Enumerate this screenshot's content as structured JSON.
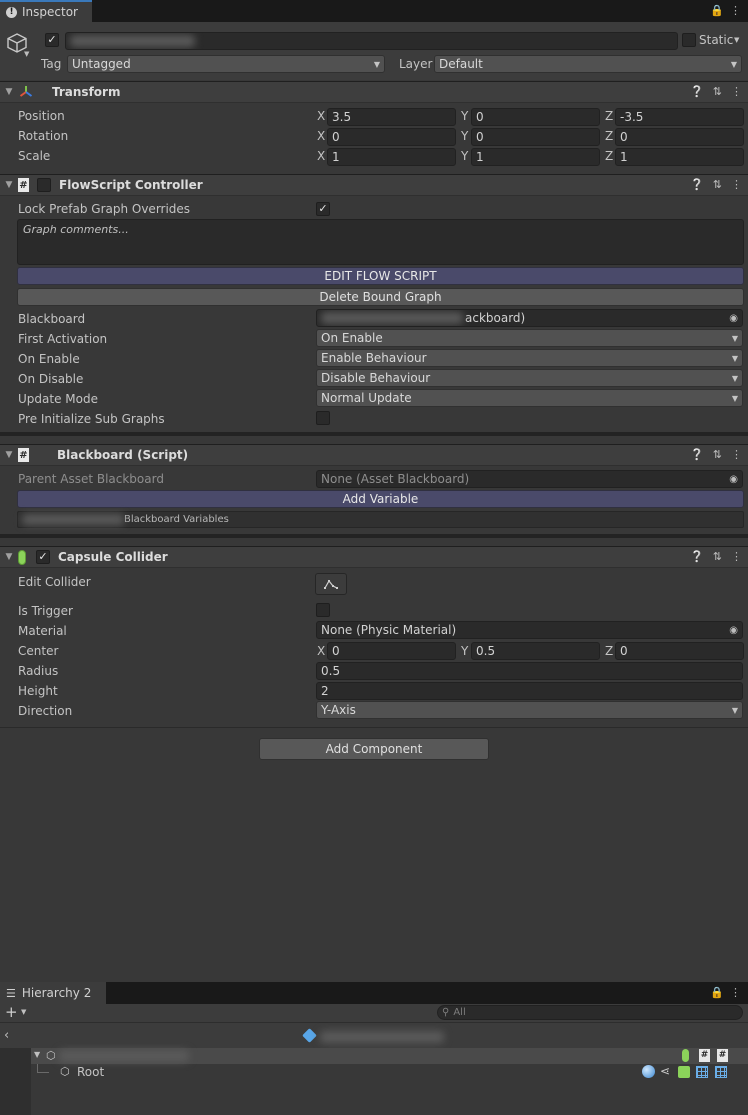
{
  "inspector": {
    "tab_label": "Inspector",
    "object": {
      "static_label": "Static"
    },
    "tag": {
      "label": "Tag",
      "value": "Untagged"
    },
    "layer": {
      "label": "Layer",
      "value": "Default"
    }
  },
  "transform": {
    "title": "Transform",
    "position": {
      "label": "Position",
      "x": "3.5",
      "y": "0",
      "z": "-3.5"
    },
    "rotation": {
      "label": "Rotation",
      "x": "0",
      "y": "0",
      "z": "0"
    },
    "scale": {
      "label": "Scale",
      "x": "1",
      "y": "1",
      "z": "1"
    },
    "axis": {
      "x": "X",
      "y": "Y",
      "z": "Z"
    }
  },
  "flowscript": {
    "title": "FlowScript Controller",
    "lock_label": "Lock Prefab Graph Overrides",
    "lock_checked": "✓",
    "comments_placeholder": "Graph comments...",
    "edit_button": "EDIT FLOW SCRIPT",
    "delete_button": "Delete Bound Graph",
    "blackboard_label": "Blackboard",
    "blackboard_value_suffix": "ackboard)",
    "first_activation": {
      "label": "First Activation",
      "value": "On Enable"
    },
    "on_enable": {
      "label": "On Enable",
      "value": "Enable Behaviour"
    },
    "on_disable": {
      "label": "On Disable",
      "value": "Disable Behaviour"
    },
    "update_mode": {
      "label": "Update Mode",
      "value": "Normal Update"
    },
    "pre_init": {
      "label": "Pre Initialize Sub Graphs"
    }
  },
  "blackboard": {
    "title": "Blackboard (Script)",
    "parent_label": "Parent Asset Blackboard",
    "parent_value": "None (Asset Blackboard)",
    "add_variable": "Add Variable",
    "variables_suffix": "Blackboard Variables"
  },
  "capsule": {
    "title": "Capsule Collider",
    "enabled_mark": "✓",
    "edit_collider": "Edit Collider",
    "is_trigger": "Is Trigger",
    "material": {
      "label": "Material",
      "value": "None (Physic Material)"
    },
    "center": {
      "label": "Center",
      "x": "0",
      "y": "0.5",
      "z": "0"
    },
    "radius": {
      "label": "Radius",
      "value": "0.5"
    },
    "height": {
      "label": "Height",
      "value": "2"
    },
    "direction": {
      "label": "Direction",
      "value": "Y-Axis"
    }
  },
  "add_component": "Add Component",
  "hierarchy": {
    "tab_label": "Hierarchy 2",
    "search_placeholder": "All",
    "root_label": "Root"
  },
  "colors": {
    "accent_tab": "#3a79bb",
    "edit_button": "#4a4a6a",
    "panel_bg": "#383838"
  }
}
